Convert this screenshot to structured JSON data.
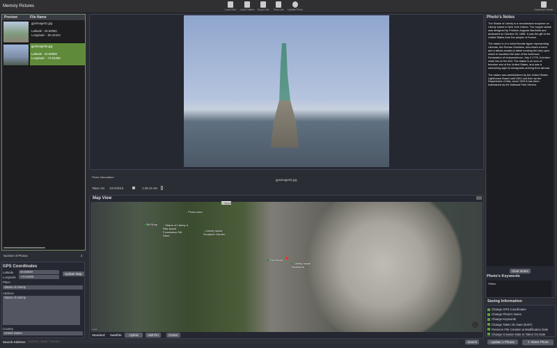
{
  "app": {
    "title": "Memory Pictures"
  },
  "toolbar": [
    {
      "label": "Load Files",
      "icon": "image-icon"
    },
    {
      "label": "Load Folders",
      "icon": "images-icon"
    },
    {
      "label": "Export List",
      "icon": "export-icon"
    },
    {
      "label": "Clear List",
      "icon": "document-icon"
    },
    {
      "label": "Update Photo",
      "icon": "refresh-icon"
    }
  ],
  "download": {
    "label": "Download Viewer"
  },
  "files": {
    "headers": [
      "Preview",
      "File Name"
    ],
    "rows": [
      {
        "name": "gpsimage01.jpg",
        "lat": "Latitude : 25.50082",
        "lon": "Longitude : -80.44424"
      },
      {
        "name": "gpsimage02.jpg",
        "lat": "Latitude : 40.68928",
        "lon": "Longitude : -74.04455"
      }
    ]
  },
  "count": {
    "label": "Number of Photos",
    "value": "2"
  },
  "gps": {
    "title": "GPS Coordinates",
    "lat_label": "Latitude",
    "lat": "40.68928",
    "lon_label": "Longitude",
    "lon": "-74.04455",
    "update": "Update Map",
    "place_label": "Place",
    "place": "Status of Liberty",
    "address_label": "Address",
    "address": "Status of Liberty",
    "country_label": "Country",
    "country": "United States"
  },
  "search": {
    "label": "Search Address",
    "placeholder": "Address, State, Country",
    "button": "Search"
  },
  "info": {
    "title": "Photo Information",
    "filename": "gpsimage02.jpg",
    "taken_label": "Taken On",
    "date": "10/ 5/2016",
    "time": "1:28:15 AM"
  },
  "map": {
    "title": "Map View",
    "labels": [
      "Island",
      "Picnic Area",
      "Gift Shop",
      "Statue of Liberty & Ellis Island Foundation Gift Store",
      "Liberty Island Sculpture Garden",
      "Fort Wood",
      "Liberty Island Bookstore"
    ],
    "types": [
      "Standard",
      "Satellite",
      "Hybrid"
    ],
    "add_pin": "Add Pin",
    "center": "Center",
    "legal": "Legal"
  },
  "notes": {
    "title": "Photo's Notes",
    "p1": "The Statue of Liberty is a neoclassical sculpture on Liberty Island in New York Harbor. The copper statue was designed by Frederic Auguste Bartholdi and dedicated on October 28, 1886. It was the gift to the United States from the people of France.",
    "p2": "The statue is of a robed female figure representing Libertas, the Roman Goddess, who bears a torch and a tabula ansata (a tablet evoking the law) upon which is inscribed the date of the American Declaration of Independence, July 4 1776. A broken chain lies at her feet. The statue is an icon of freedom and of the United States, and was a welcoming sight to immigrants arriving from abroad.",
    "p3": "The statue was administered by the United States Lighthouse Board until 1901 and then by the Department of War, since 1933 it has been maintained by the National Park Service.",
    "clear": "Clear Notes"
  },
  "keywords": {
    "title": "Photo's Keywords",
    "value": "Status"
  },
  "saving": {
    "title": "Saving Information",
    "options": [
      "Change GPS Coordinates",
      "Change Photo's Notes",
      "Change Keywords",
      "Change Taken On Date (EXIF)",
      "Preserve File Creation & Modification Date",
      "Change Creation Date to Taken On Date"
    ]
  },
  "actions": {
    "update": "Update 1 Photos",
    "share": "Share Photo"
  }
}
